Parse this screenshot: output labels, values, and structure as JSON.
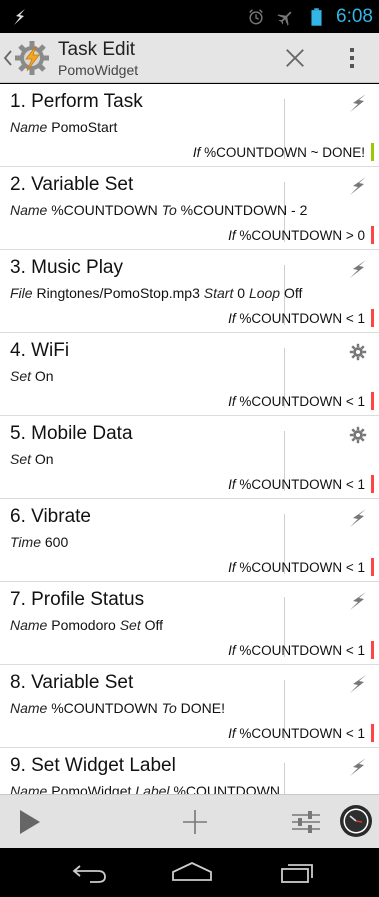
{
  "status_bar": {
    "time": "6:08"
  },
  "header": {
    "title": "Task Edit",
    "subtitle": "PomoWidget"
  },
  "actions": [
    {
      "title": "1.  Perform Task",
      "detail": [
        [
          "Name ",
          "PomoStart"
        ]
      ],
      "cond_if": "If",
      "cond_text": " %COUNTDOWN ~ DONE!",
      "icon": "lightning-icon",
      "status_color": "#99cc00"
    },
    {
      "title": "2.  Variable Set",
      "detail": [
        [
          "Name ",
          "%COUNTDOWN "
        ],
        [
          "To ",
          "%COUNTDOWN - 2"
        ]
      ],
      "cond_if": "If",
      "cond_text": " %COUNTDOWN > 0",
      "icon": "lightning-icon",
      "status_color": "#ff4444"
    },
    {
      "title": "3.  Music Play",
      "detail": [
        [
          "File ",
          "Ringtones/PomoStop.mp3 "
        ],
        [
          "Start ",
          "0 "
        ],
        [
          "Loop ",
          "Off"
        ]
      ],
      "cond_if": "If",
      "cond_text": " %COUNTDOWN < 1",
      "icon": "lightning-icon",
      "status_color": "#ff4444"
    },
    {
      "title": "4.  WiFi",
      "detail": [
        [
          "Set ",
          "On"
        ]
      ],
      "cond_if": "If",
      "cond_text": " %COUNTDOWN < 1",
      "icon": "gear-icon",
      "status_color": "#ff4444"
    },
    {
      "title": "5.  Mobile Data",
      "detail": [
        [
          "Set ",
          "On"
        ]
      ],
      "cond_if": "If",
      "cond_text": " %COUNTDOWN < 1",
      "icon": "gear-icon",
      "status_color": "#ff4444"
    },
    {
      "title": "6.  Vibrate",
      "detail": [
        [
          "Time ",
          "600"
        ]
      ],
      "cond_if": "If",
      "cond_text": " %COUNTDOWN < 1",
      "icon": "lightning-icon",
      "status_color": "#ff4444"
    },
    {
      "title": "7.  Profile Status",
      "detail": [
        [
          "Name ",
          "Pomodoro "
        ],
        [
          "Set ",
          "Off"
        ]
      ],
      "cond_if": "If",
      "cond_text": " %COUNTDOWN < 1",
      "icon": "lightning-icon",
      "status_color": "#ff4444"
    },
    {
      "title": "8.  Variable Set",
      "detail": [
        [
          "Name ",
          "%COUNTDOWN "
        ],
        [
          "To ",
          "DONE!"
        ]
      ],
      "cond_if": "If",
      "cond_text": " %COUNTDOWN < 1",
      "icon": "lightning-icon",
      "status_color": "#ff4444"
    },
    {
      "title": "9.  Set Widget Label",
      "detail": [
        [
          "Name ",
          "PomoWidget "
        ],
        [
          "Label ",
          "%COUNTDOWN"
        ]
      ],
      "cond_if": "",
      "cond_text": "",
      "icon": "lightning-icon",
      "status_color": ""
    }
  ]
}
